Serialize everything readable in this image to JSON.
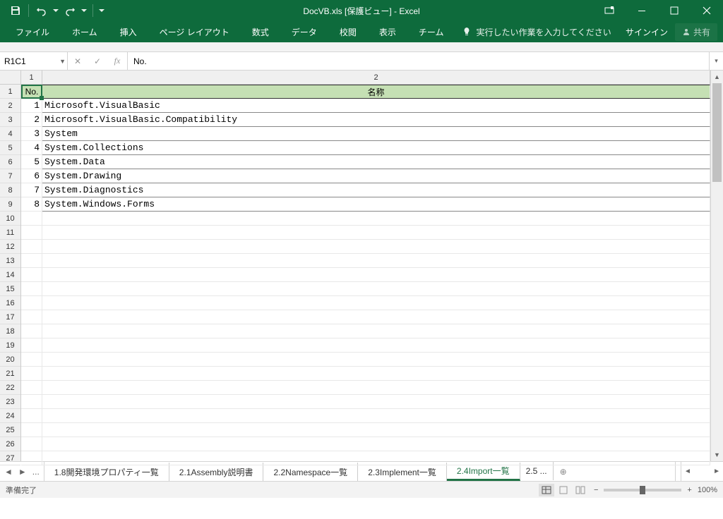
{
  "title": "DocVB.xls  [保護ビュー] - Excel",
  "ribbon": {
    "tabs": [
      "ファイル",
      "ホーム",
      "挿入",
      "ページ レイアウト",
      "数式",
      "データ",
      "校閲",
      "表示",
      "チーム"
    ],
    "tellme": "実行したい作業を入力してください",
    "signin": "サインイン",
    "share": "共有"
  },
  "formula": {
    "name_box": "R1C1",
    "value": "No."
  },
  "columns": {
    "c1": "1",
    "c2": "2"
  },
  "header_row": {
    "c1": "No.",
    "c2": "名称"
  },
  "rows": [
    {
      "n": "1",
      "name": "Microsoft.VisualBasic"
    },
    {
      "n": "2",
      "name": "Microsoft.VisualBasic.Compatibility"
    },
    {
      "n": "3",
      "name": "System"
    },
    {
      "n": "4",
      "name": "System.Collections"
    },
    {
      "n": "5",
      "name": "System.Data"
    },
    {
      "n": "6",
      "name": "System.Drawing"
    },
    {
      "n": "7",
      "name": "System.Diagnostics"
    },
    {
      "n": "8",
      "name": "System.Windows.Forms"
    }
  ],
  "row_count": 27,
  "sheets": {
    "prev_trunc": "...",
    "tabs": [
      "1.8開発環境プロパティ一覧",
      "2.1Assembly説明書",
      "2.2Namespace一覧",
      "2.3Implement一覧",
      "2.4Import一覧"
    ],
    "next_trunc": "2.5",
    "ellipsis": "...",
    "active_index": 4
  },
  "status": {
    "ready": "準備完了",
    "zoom": "100%"
  }
}
